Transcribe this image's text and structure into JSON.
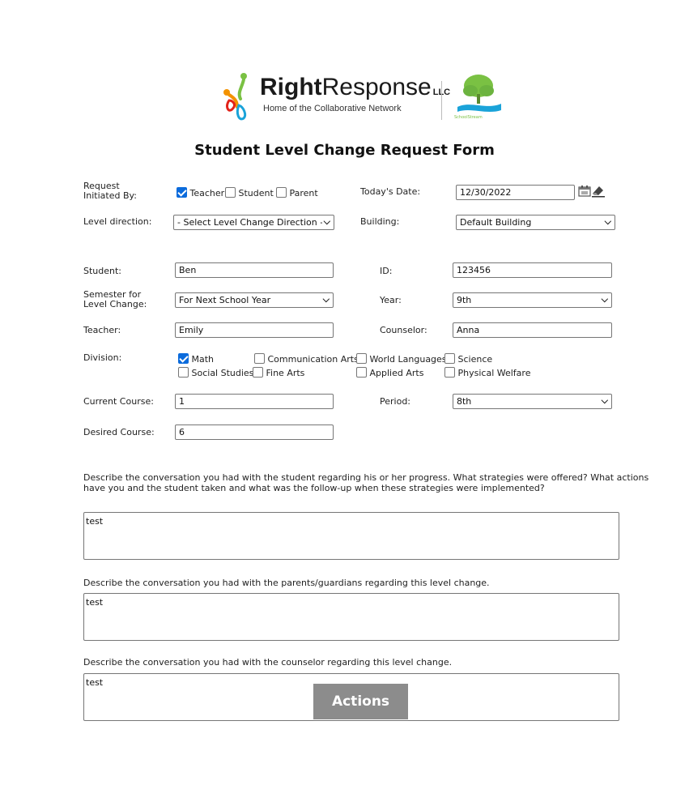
{
  "logo": {
    "brand_bold": "Right",
    "brand_light": "Response",
    "brand_suffix": "LLC",
    "tagline": "Home of the Collaborative Network",
    "partner": "SchoolStream"
  },
  "form_title": "Student Level Change Request Form",
  "request": {
    "label": "Request Initiated By:",
    "options": [
      {
        "label": "Teacher",
        "checked": true
      },
      {
        "label": "Student",
        "checked": false
      },
      {
        "label": "Parent",
        "checked": false
      }
    ]
  },
  "todays_date": {
    "label": "Today's Date:",
    "value": "12/30/2022"
  },
  "level_direction": {
    "label": "Level direction:",
    "value": "- Select Level Change Direction -"
  },
  "building": {
    "label": "Building:",
    "value": "Default Building"
  },
  "student": {
    "label": "Student:",
    "value": "Ben"
  },
  "id": {
    "label": "ID:",
    "value": "123456"
  },
  "semester": {
    "label": "Semester for Level Change:",
    "value": "For Next School Year"
  },
  "year": {
    "label": "Year:",
    "value": "9th"
  },
  "teacher": {
    "label": "Teacher:",
    "value": "Emily"
  },
  "counselor": {
    "label": "Counselor:",
    "value": "Anna"
  },
  "division": {
    "label": "Division:",
    "options": [
      {
        "label": "Math",
        "checked": true
      },
      {
        "label": "Communication Arts",
        "checked": false
      },
      {
        "label": "World Languages",
        "checked": false
      },
      {
        "label": "Science",
        "checked": false
      },
      {
        "label": "Social Studies",
        "checked": false
      },
      {
        "label": "Fine Arts",
        "checked": false
      },
      {
        "label": "Applied Arts",
        "checked": false
      },
      {
        "label": "Physical Welfare",
        "checked": false
      }
    ]
  },
  "current_course": {
    "label": "Current Course:",
    "value": "1"
  },
  "period": {
    "label": "Period:",
    "value": "8th"
  },
  "desired_course": {
    "label": "Desired Course:",
    "value": "6"
  },
  "q1": {
    "prompt": "Describe the conversation you had with the student regarding his or her progress. What strategies were offered? What actions have you and the student taken and what was the follow-up when these strategies were implemented?",
    "answer": "test"
  },
  "q2": {
    "prompt": "Describe the conversation you had with the parents/guardians regarding this level change.",
    "answer": "test"
  },
  "q3": {
    "prompt": "Describe the conversation you had with the counselor regarding this level change.",
    "answer": "test"
  },
  "actions_button": "Actions",
  "colors": {
    "checkbox_checked": "#0b6bdc",
    "actions_bg": "#8c8c8c",
    "tree_green": "#7ac143",
    "water_blue": "#1aa3d9"
  }
}
